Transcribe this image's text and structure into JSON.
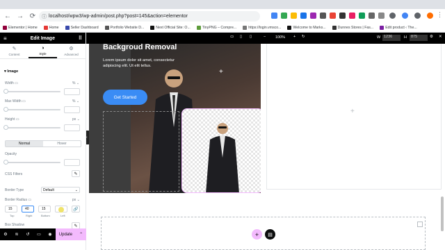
{
  "browser": {
    "url": "localhost/wpw3/wp-admin/post.php?post=145&action=elementor",
    "bookmarks": [
      "Elementor | Home",
      "Home",
      "Seller Dashboard",
      "Portfolio Website D...",
      "Next Official Site: O...",
      "TinyPNG – Compre...",
      "https://login.vmsco...",
      "Welcome to Marks...",
      "Dunnes Stores | Fas...",
      "Edit product ‹ The..."
    ]
  },
  "panel": {
    "title": "Edit Image",
    "tabs": [
      "Content",
      "Style",
      "Advanced"
    ],
    "active_tab": "Style",
    "section": "Image",
    "width_label": "Width",
    "width_unit": "% ⌄",
    "maxwidth_label": "Max Width",
    "maxwidth_unit": "% ⌄",
    "height_label": "Height",
    "height_unit": "px ⌄",
    "state_normal": "Normal",
    "state_hover": "Hover",
    "opacity_label": "Opacity",
    "css_filters_label": "CSS Filters",
    "border_type_label": "Border Type",
    "border_type_value": "Default",
    "border_radius_label": "Border Radius",
    "border_radius_unit": "px ⌄",
    "radius": {
      "top": "15",
      "right": "40",
      "bottom": "15",
      "left": ""
    },
    "radius_labels": {
      "top": "Top",
      "right": "Right",
      "bottom": "Bottom",
      "left": "Left"
    },
    "box_shadow_label": "Box Shadow",
    "update_label": "Update"
  },
  "topbar": {
    "zoom": "100%",
    "width_label": "W",
    "width_value": "1236",
    "height_label": "H",
    "height_value": "875"
  },
  "hero": {
    "title": "Backgroud Removal",
    "text": "Lorem ipsum dolor sit amet, consectetur adipiscing elit. Ut elit tellus.",
    "button": "Get Started"
  },
  "colors": {
    "accent": "#3a8cf5",
    "elementor_pink": "#f3bafd",
    "panel_bar": "#000000"
  }
}
